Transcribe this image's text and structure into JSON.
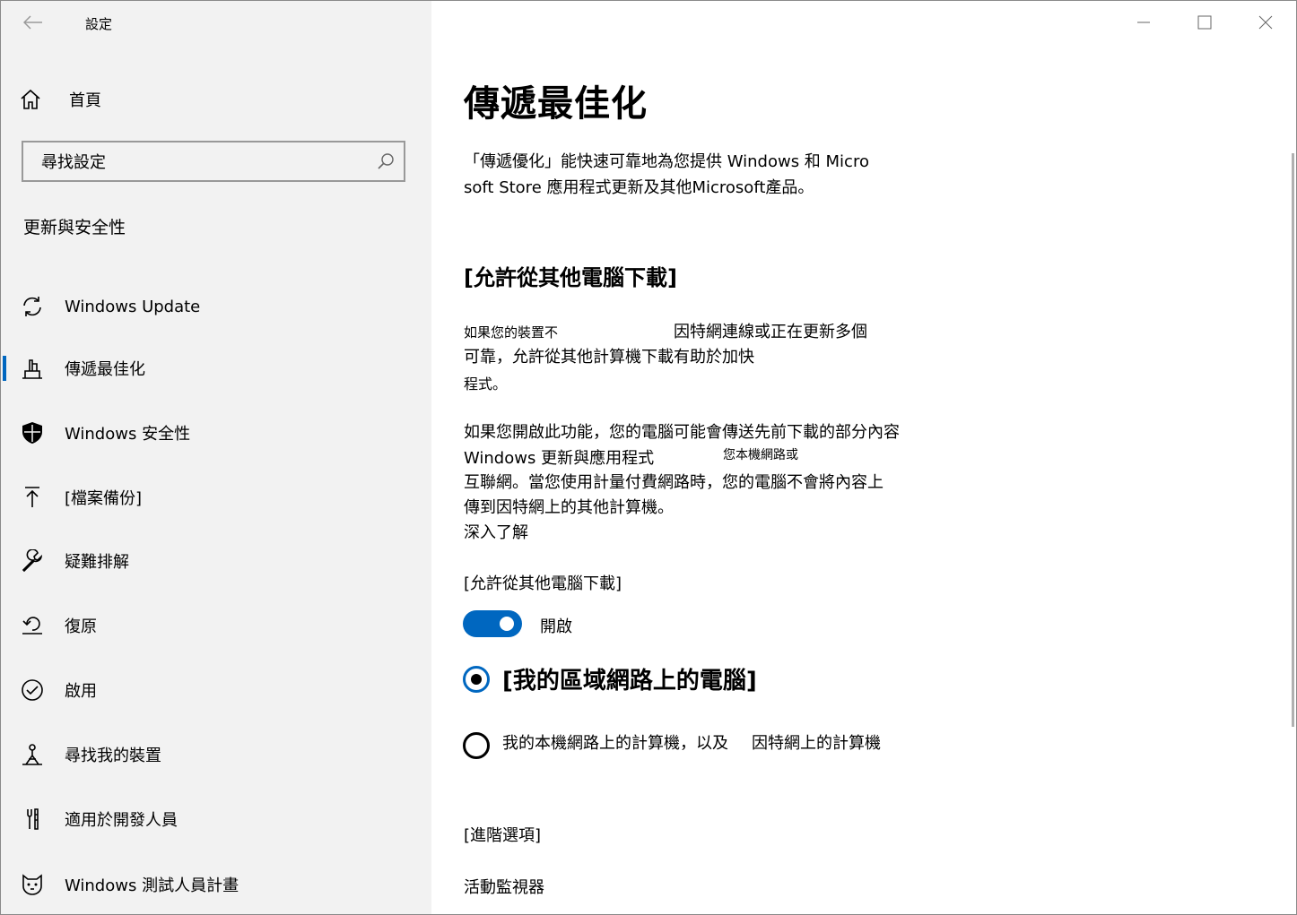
{
  "window": {
    "title": "設定",
    "controls": [
      "minimize-icon",
      "maximize-icon",
      "close-icon"
    ]
  },
  "sidebar": {
    "home_label": "首頁",
    "search_placeholder": "尋找設定",
    "section_title": "更新與安全性",
    "items": [
      {
        "label": "Windows Update",
        "icon": "sync-icon"
      },
      {
        "label": "傳遞最佳化",
        "icon": "delivery-icon",
        "selected": true
      },
      {
        "label": "Windows 安全性",
        "icon": "shield-icon"
      },
      {
        "label": "[檔案備份]",
        "icon": "upload-arrow-icon"
      },
      {
        "label": "疑難排解",
        "icon": "wrench-icon"
      },
      {
        "label": "復原",
        "icon": "recovery-icon"
      },
      {
        "label": "啟用",
        "icon": "check-circle-icon"
      },
      {
        "label": "尋找我的裝置",
        "icon": "find-device-icon"
      },
      {
        "label": "適用於開發人員",
        "icon": "developer-icon"
      },
      {
        "label": "Windows 測試人員計畫",
        "icon": "insider-cat-icon"
      }
    ]
  },
  "main": {
    "title": "傳遞最佳化",
    "intro_line1": "「傳遞優化」能快速可靠地為您提供 Windows 和 Micro",
    "intro_line2": "soft Store 應用程式更新及其他Microsoft產品。",
    "section_heading": "[允許從其他電腦下載]",
    "para1_line1a": "如果您的裝置不",
    "para1_line1b": "因特網連線或正在更新多個",
    "para1_line2": "可靠，允許從其他計算機下載有助於加快",
    "para1_line3": "程式。",
    "para2_line1": "如果您開啟此功能，您的電腦可能會傳送先前下載的部分內容",
    "para2_line2a": "Windows 更新與應用程式",
    "para2_line2b": "您本機網路或",
    "para2_line3": "互聯網。當您使用計量付費網路時，您的電腦不會將內容上",
    "para2_line4": "傳到因特網上的其他計算機。",
    "learn_more": "深入了解",
    "toggle_label": "[允許從其他電腦下載]",
    "toggle_state": "開啟",
    "toggle_on": true,
    "radio1_label": "[我的區域網路上的電腦]",
    "radio2_label_a": "我的本機網路上的計算機，以及",
    "radio2_label_b": "因特網上的計算機",
    "advanced_options": "[進階選項]",
    "activity_monitor": "活動監視器"
  },
  "colors": {
    "accent": "#0067c0",
    "sidebar_bg": "#f2f2f2"
  }
}
